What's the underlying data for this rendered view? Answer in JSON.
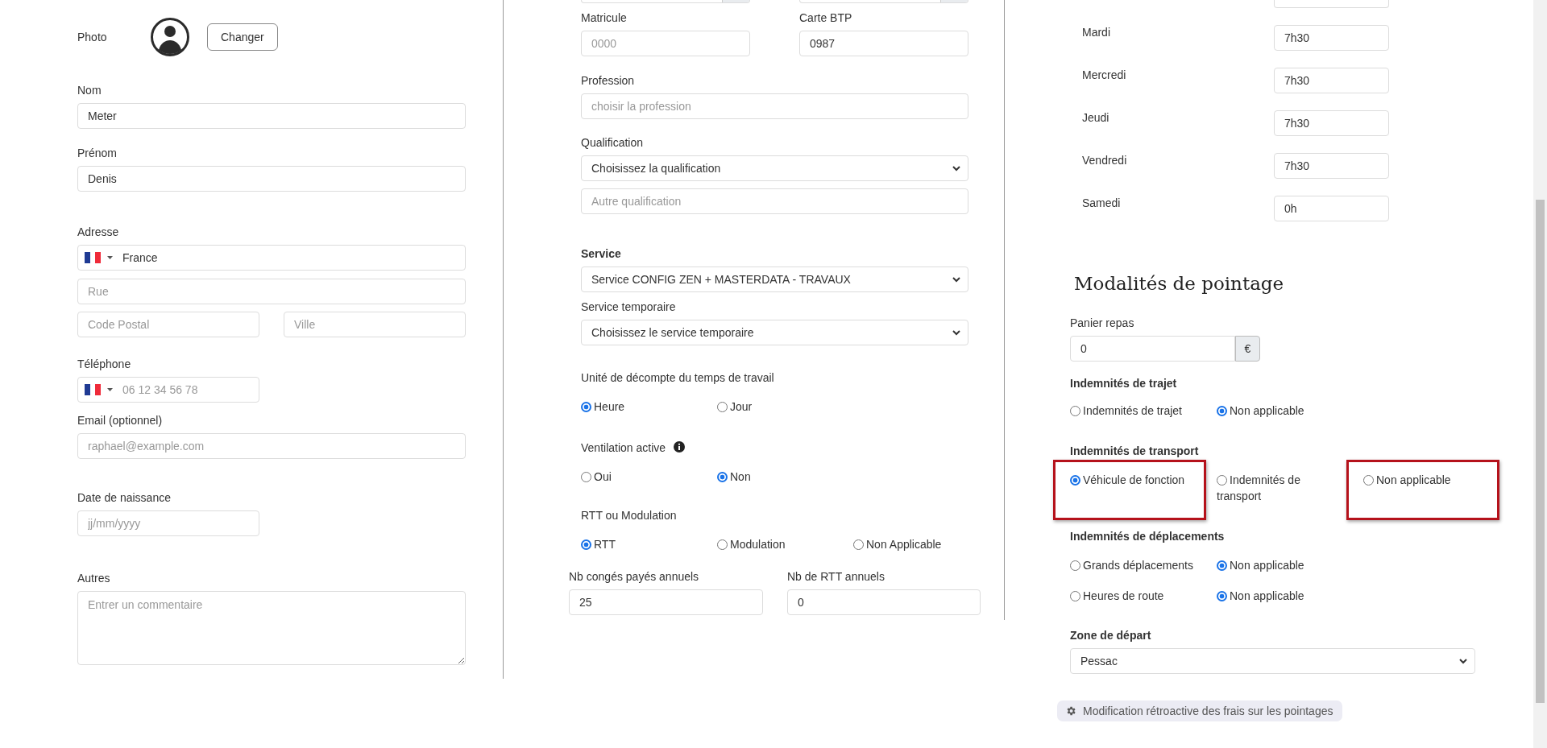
{
  "identity": {
    "photo_label": "Photo",
    "change_button": "Changer",
    "last_name": {
      "label": "Nom",
      "value": "Meter"
    },
    "first_name": {
      "label": "Prénom",
      "value": "Denis"
    },
    "address": {
      "label": "Adresse",
      "country": "France",
      "street_placeholder": "Rue",
      "postal_placeholder": "Code Postal",
      "city_placeholder": "Ville"
    },
    "phone": {
      "label": "Téléphone",
      "placeholder": "06 12 34 56 78"
    },
    "email": {
      "label": "Email (optionnel)",
      "placeholder": "raphael@example.com"
    },
    "birth_date": {
      "label": "Date de naissance",
      "placeholder": "jj/mm/yyyy"
    },
    "notes": {
      "label": "Autres",
      "placeholder": "Entrer un commentaire"
    }
  },
  "employment": {
    "matricule": {
      "label": "Matricule",
      "placeholder": "0000"
    },
    "btp_card": {
      "label": "Carte BTP",
      "value": "0987"
    },
    "profession": {
      "label": "Profession",
      "placeholder": "choisir la profession"
    },
    "qualification": {
      "label": "Qualification",
      "value": "Choisissez la qualification",
      "other_placeholder": "Autre qualification"
    },
    "service": {
      "label": "Service",
      "value": "Service CONFIG ZEN + MASTERDATA - TRAVAUX"
    },
    "temp_service": {
      "label": "Service temporaire",
      "value": "Choisissez le service temporaire"
    },
    "work_unit": {
      "label": "Unité de décompte du temps de travail",
      "options": [
        {
          "label": "Heure",
          "selected": true
        },
        {
          "label": "Jour",
          "selected": false
        }
      ]
    },
    "ventilation": {
      "label": "Ventilation active",
      "options": [
        {
          "label": "Oui",
          "selected": false
        },
        {
          "label": "Non",
          "selected": true
        }
      ]
    },
    "rtt": {
      "label": "RTT ou Modulation",
      "options": [
        {
          "label": "RTT",
          "selected": true
        },
        {
          "label": "Modulation",
          "selected": false
        },
        {
          "label": "Non Applicable",
          "selected": false
        }
      ]
    },
    "paid_leave": {
      "label": "Nb congés payés annuels",
      "value": "25"
    },
    "rtt_count": {
      "label": "Nb de RTT annuels",
      "value": "0"
    }
  },
  "schedule": {
    "days": [
      {
        "label": "Mardi",
        "value": "7h30"
      },
      {
        "label": "Mercredi",
        "value": "7h30"
      },
      {
        "label": "Jeudi",
        "value": "7h30"
      },
      {
        "label": "Vendredi",
        "value": "7h30"
      },
      {
        "label": "Samedi",
        "value": "0h"
      }
    ]
  },
  "clocking": {
    "title": "Modalités de pointage",
    "meal": {
      "label": "Panier repas",
      "value": "0",
      "unit": "€"
    },
    "groups": [
      {
        "label": "Indemnités de trajet",
        "rows": [
          [
            {
              "label": "Indemnités de trajet",
              "selected": false,
              "highlighted": false
            },
            {
              "label": "Non applicable",
              "selected": true,
              "highlighted": false
            }
          ]
        ]
      },
      {
        "label": "Indemnités de transport",
        "rows": [
          [
            {
              "label": "Véhicule de fonction",
              "selected": true,
              "highlighted": true
            },
            {
              "label": "Indemnités de transport",
              "selected": false,
              "highlighted": false
            },
            {
              "label": "Non applicable",
              "selected": false,
              "highlighted": true
            }
          ]
        ]
      },
      {
        "label": "Indemnités de déplacements",
        "rows": [
          [
            {
              "label": "Grands déplacements",
              "selected": false,
              "highlighted": false
            },
            {
              "label": "Non applicable",
              "selected": true,
              "highlighted": false
            }
          ],
          [
            {
              "label": "Heures de route",
              "selected": false,
              "highlighted": false
            },
            {
              "label": "Non applicable",
              "selected": true,
              "highlighted": false
            }
          ]
        ]
      }
    ],
    "departure_zone": {
      "label": "Zone de départ",
      "value": "Pessac"
    },
    "retro_button": "Modification rétroactive des frais sur les pointages"
  }
}
